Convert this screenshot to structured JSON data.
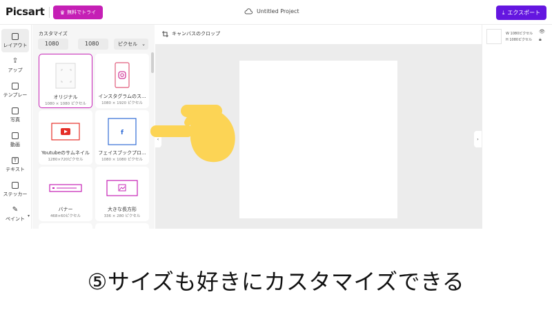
{
  "header": {
    "logo": "Picsart",
    "trial_label": "無料でトライ",
    "project_name": "Untitled Project",
    "export_label": "エクスポート"
  },
  "rail": {
    "items": [
      {
        "label": "レイアウト",
        "icon": "layout-icon",
        "active": true
      },
      {
        "label": "アップ",
        "icon": "upload-icon"
      },
      {
        "label": "テンプレー",
        "icon": "templates-icon"
      },
      {
        "label": "写真",
        "icon": "photo-icon"
      },
      {
        "label": "動画",
        "icon": "video-icon"
      },
      {
        "label": "テキスト",
        "icon": "text-icon"
      },
      {
        "label": "ステッカー",
        "icon": "sticker-icon"
      },
      {
        "label": "ペイント",
        "icon": "brush-icon"
      }
    ]
  },
  "panel": {
    "title": "カスタマイズ",
    "width_value": "1080",
    "height_value": "1080",
    "unit": "ピクセル",
    "cards": [
      {
        "name": "オリジナル",
        "size": "1080 × 1080 ピクセル"
      },
      {
        "name": "インスタグラムのス...",
        "size": "1080 × 1920 ピクセル"
      },
      {
        "name": "Youtubeのサムネイル",
        "size": "1280×720ピクセル"
      },
      {
        "name": "フェイスブックプロ...",
        "size": "1080 × 1080 ピクセル"
      },
      {
        "name": "バナー",
        "size": "468×60ピクセル"
      },
      {
        "name": "大きな長方形",
        "size": "336 × 280 ピクセル"
      }
    ]
  },
  "canvas": {
    "crop_label": "キャンバスのクロップ"
  },
  "layer": {
    "width_text": "W 1080ピクセル",
    "height_text": "H 1080ピクセル"
  },
  "caption": "⑤サイズも好きにカスタマイズできる",
  "colors": {
    "accent": "#c51fb5",
    "export": "#6416e0",
    "youtube": "#e52d27",
    "facebook": "#2f6bd6",
    "hand": "#fcd455"
  }
}
